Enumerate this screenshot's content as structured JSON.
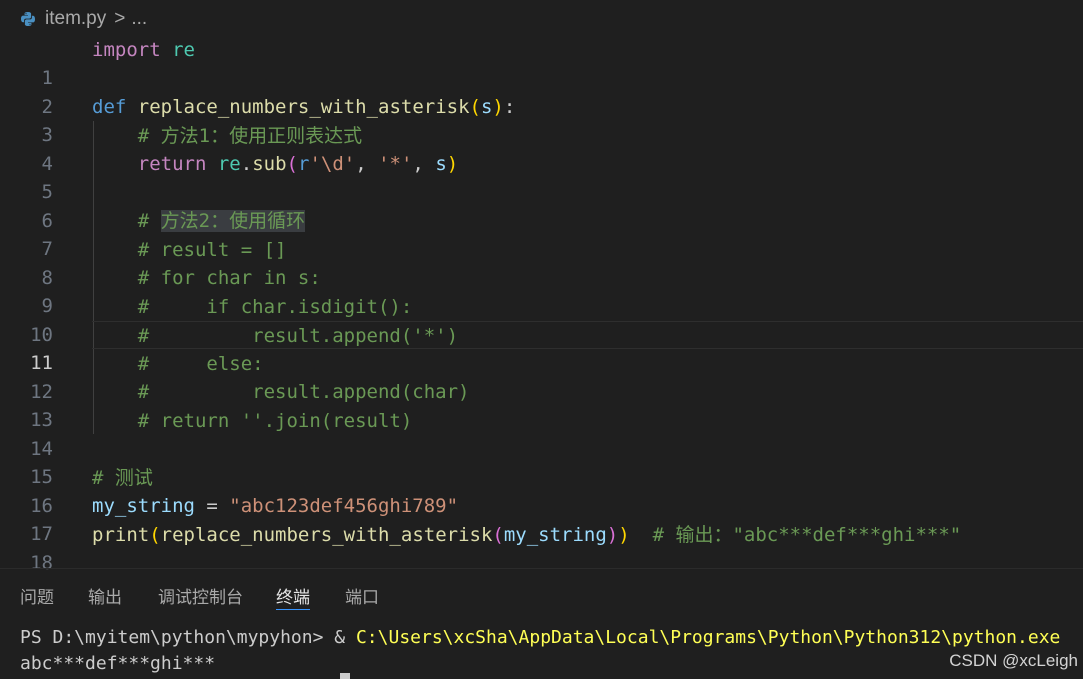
{
  "breadcrumb": {
    "file": "item.py",
    "separator": ">",
    "more": "..."
  },
  "editor": {
    "current_line": 11,
    "line_numbers": [
      "1",
      "2",
      "3",
      "4",
      "5",
      "6",
      "7",
      "8",
      "9",
      "10",
      "11",
      "12",
      "13",
      "14",
      "15",
      "16",
      "17",
      "18"
    ],
    "tokens": {
      "import": "import",
      "re": "re",
      "def": "def",
      "func_name": "replace_numbers_with_asterisk",
      "paren_open": "(",
      "paren_close": ")",
      "param_s": "s",
      "colon": ":",
      "cm4": "# 方法1：使用正则表达式",
      "return": "return",
      "re_mod": "re",
      "dot": ".",
      "sub": "sub",
      "r_prefix": "r",
      "pattern": "'\\d'",
      "comma": ", ",
      "star_str": "'*'",
      "cm7_hash": "# ",
      "cm7_text": "方法2：使用循环",
      "cm8": "# result = []",
      "cm9": "# for char in s:",
      "cm10": "#     if char.isdigit():",
      "cm11": "#         result.append('*')",
      "cm12": "#     else:",
      "cm13": "#         result.append(char)",
      "cm14": "# return ''.join(result)",
      "cm16": "# 测试",
      "my_string": "my_string",
      "assign": " = ",
      "str_value": "\"abc123def456ghi789\"",
      "print": "print",
      "cm18": "# 输出：\"abc***def***ghi***\""
    }
  },
  "panel": {
    "tabs": [
      "问题",
      "输出",
      "调试控制台",
      "终端",
      "端口"
    ],
    "active_tab": "终端",
    "terminal": {
      "prompt": "PS D:\\myitem\\python\\mypyhon> ",
      "amp": "& ",
      "command": "C:\\Users\\xcSha\\AppData\\Local\\Programs\\Python\\Python312\\python.exe",
      "output": "abc***def***ghi***"
    }
  },
  "watermark": "CSDN @xcLeigh",
  "colors": {
    "background": "#1f1f1f",
    "keyword": "#569cd6",
    "function": "#dcdcaa",
    "string": "#ce9178",
    "comment": "#6a9955",
    "active_tab_underline": "#3794ff"
  }
}
